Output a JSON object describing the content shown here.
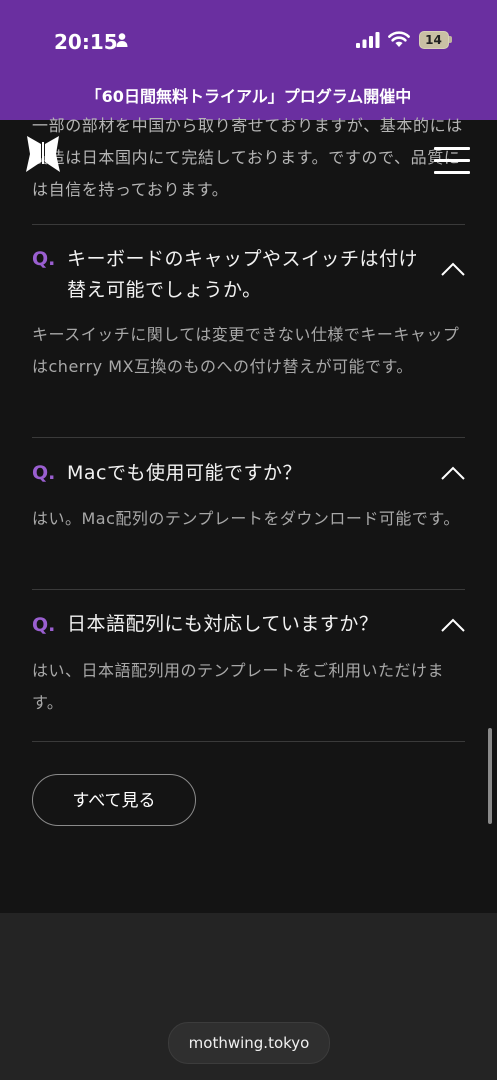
{
  "status_bar": {
    "time": "20:15",
    "battery": "14"
  },
  "banner": {
    "text": "「60日間無料トライアル」プログラム開催中"
  },
  "faq": {
    "intro_text": "一部の部材を中国から取り寄せておりますが、基本的には製造は日本国内にて完結しております。ですので、品質には自信を持っております。",
    "items": [
      {
        "q_mark": "Q.",
        "question": "キーボードのキャップやスイッチは付け替え可能でしょうか。",
        "answer": "キースイッチに関しては変更できない仕様でキーキャップはcherry MX互換のものへの付け替えが可能です。"
      },
      {
        "q_mark": "Q.",
        "question": "Macでも使用可能ですか？",
        "answer": "はい。Mac配列のテンプレートをダウンロード可能です。"
      },
      {
        "q_mark": "Q.",
        "question": "日本語配列にも対応していますか？",
        "answer": "はい、日本語配列用のテンプレートをご利用いただけます。"
      }
    ],
    "view_all_label": "すべて見る"
  },
  "browser": {
    "url": "mothwing.tokyo"
  },
  "colors": {
    "accent": "#6a2fa0",
    "q_mark": "#9a5fd0",
    "background": "#141414"
  }
}
